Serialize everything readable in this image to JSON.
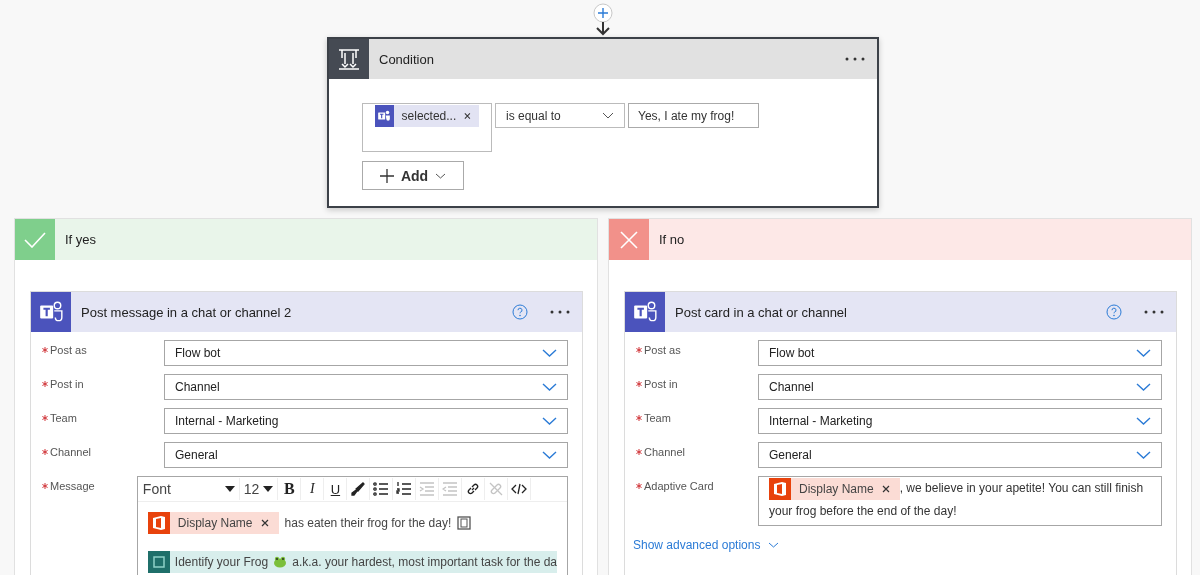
{
  "condition": {
    "title": "Condition",
    "token": "selected...",
    "operator": "is equal to",
    "value": "Yes, I ate my frog!",
    "add_label": "Add"
  },
  "branches": [
    {
      "kind": "yes",
      "title": "If yes",
      "card": {
        "title": "Post message in a chat or channel 2",
        "fields": [
          {
            "label": "Post as",
            "required": true,
            "kind": "dropdown",
            "value": "Flow bot"
          },
          {
            "label": "Post in",
            "required": true,
            "kind": "dropdown",
            "value": "Channel"
          },
          {
            "label": "Team",
            "required": true,
            "kind": "dropdown",
            "value": "Internal - Marketing"
          },
          {
            "label": "Channel",
            "required": true,
            "kind": "dropdown",
            "value": "General"
          },
          {
            "label": "Message",
            "required": true,
            "kind": "richtext",
            "toolbar": [
              {
                "kind": "font",
                "label": "Font",
                "disabled": false
              },
              {
                "kind": "size",
                "label": "12",
                "disabled": false
              },
              {
                "kind": "bold",
                "label": "B",
                "disabled": false
              },
              {
                "kind": "italic",
                "label": "I",
                "disabled": false
              },
              {
                "kind": "underline",
                "label": "U",
                "disabled": false
              },
              {
                "kind": "brush",
                "disabled": false
              },
              {
                "kind": "bullets",
                "disabled": false
              },
              {
                "kind": "numbers",
                "disabled": false
              },
              {
                "kind": "indent",
                "disabled": true
              },
              {
                "kind": "outdent",
                "disabled": true
              },
              {
                "kind": "link",
                "disabled": false
              },
              {
                "kind": "unlink",
                "disabled": true
              },
              {
                "kind": "code",
                "disabled": false
              }
            ],
            "token": "Display Name",
            "text": "has eaten their frog for the day!",
            "note_before": "Identify your Frog",
            "note_after": "a.k.a. your hardest, most important task for the da"
          }
        ]
      }
    },
    {
      "kind": "no",
      "title": "If no",
      "card": {
        "title": "Post card in a chat or channel",
        "fields": [
          {
            "label": "Post as",
            "required": true,
            "kind": "dropdown",
            "value": "Flow bot"
          },
          {
            "label": "Post in",
            "required": true,
            "kind": "dropdown",
            "value": "Channel"
          },
          {
            "label": "Team",
            "required": true,
            "kind": "dropdown",
            "value": "Internal - Marketing"
          },
          {
            "label": "Channel",
            "required": true,
            "kind": "dropdown",
            "value": "General"
          },
          {
            "label": "Adaptive Card",
            "required": true,
            "kind": "tokentext",
            "token": "Display Name",
            "text": ", we believe in your apetite! You can still finish your frog before the end of the day!"
          }
        ],
        "advanced": "Show advanced options"
      }
    }
  ]
}
